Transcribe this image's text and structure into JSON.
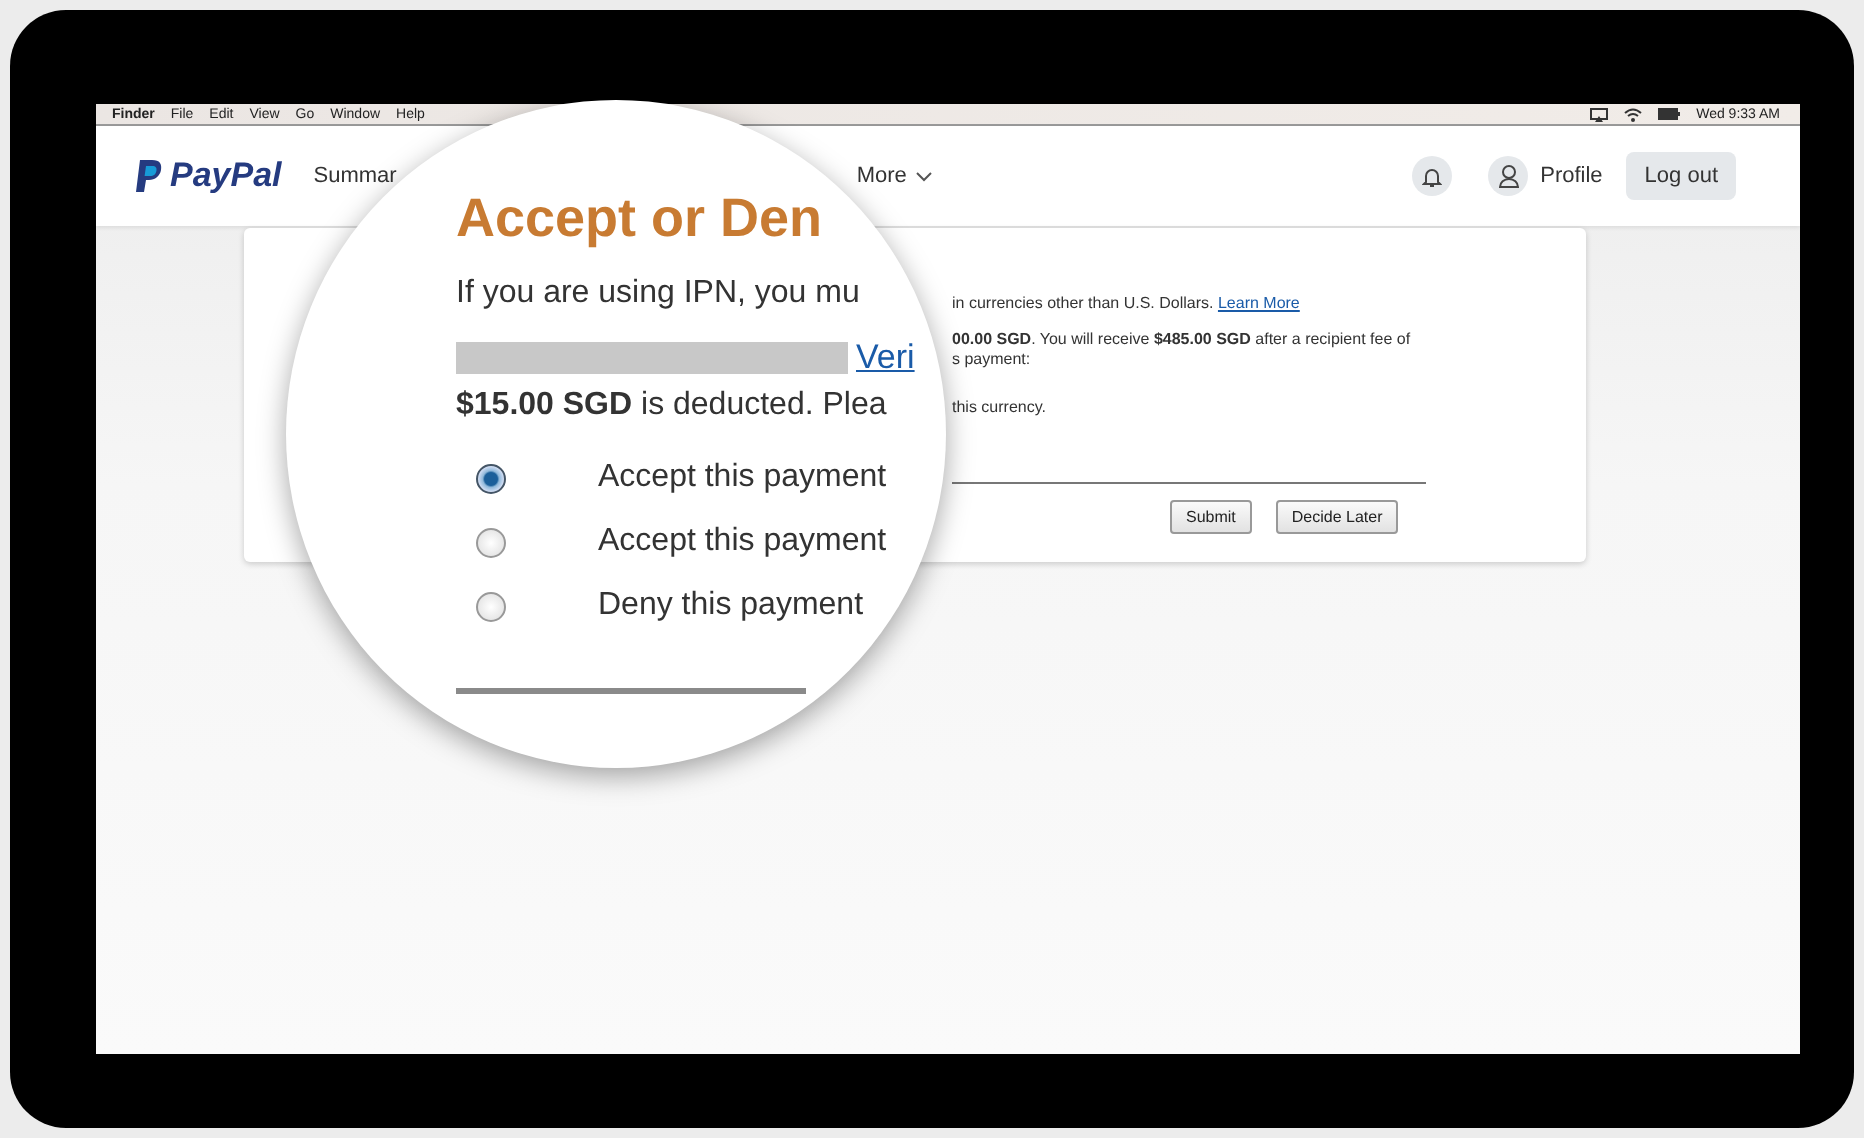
{
  "menu_bar": {
    "app": "Finder",
    "menus": [
      "File",
      "Edit",
      "View",
      "Go",
      "Window",
      "Help"
    ],
    "clock": "Wed 9:33 AM"
  },
  "header": {
    "brand": "PayPal",
    "nav": [
      {
        "label": "Summar",
        "dropdown": false
      },
      {
        "label": "More",
        "dropdown": true
      }
    ],
    "profile": "Profile",
    "logout": "Log out"
  },
  "card": {
    "paragraphs": [
      [
        {
          "text": "in currencies other than U.S. Dollars.",
          "link": "Learn More"
        }
      ],
      [
        {
          "text": "**00.00 SGD**. You will receive **$485.00 SGD** after a recipient fee of"
        },
        {
          "text": "s payment:"
        }
      ],
      [
        {
          "text": "this currency."
        }
      ]
    ],
    "buttons": [
      "Submit",
      "Decide Later"
    ]
  },
  "magnifier": {
    "title": "Accept or Den",
    "intro": "If you are using IPN, you mu",
    "link": "Veri",
    "fee_text": "**$15.00 SGD** is deducted. Plea",
    "options": [
      {
        "label": "Accept this payment",
        "selected": true
      },
      {
        "label": "Accept this payment",
        "selected": false
      },
      {
        "label": "Deny this payment",
        "selected": false
      }
    ]
  }
}
